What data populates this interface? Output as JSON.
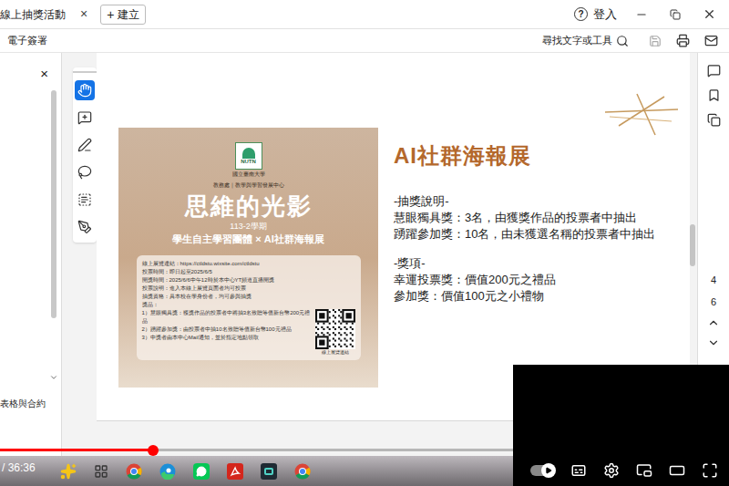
{
  "browser": {
    "tab_title": "線上抽獎活動",
    "tab_close": "×",
    "new_tab_icon": "+",
    "new_tab": "建立",
    "help": "?",
    "login": "登入"
  },
  "toolbar": {
    "left": "電子簽署",
    "search": "尋找文字或工具"
  },
  "left_panel": {
    "close": "×",
    "item": "表格與合約"
  },
  "tools": [
    {
      "kind": "hand",
      "selected": true
    },
    {
      "kind": "comment",
      "selected": false
    },
    {
      "kind": "pen",
      "selected": false
    },
    {
      "kind": "lasso",
      "selected": false
    },
    {
      "kind": "text-select",
      "selected": false
    },
    {
      "kind": "sign",
      "selected": false
    }
  ],
  "poster": {
    "logo": "NUTN",
    "school": "國立臺南大學",
    "unit": "教務處｜教學與學習發展中心",
    "title": "思維的光影",
    "term": "113-2學期",
    "subtitle": "學生自主學習團體 × AI社群海報展",
    "info": [
      "線上展覽連結：https://ctldstu.wixsite.com/ctldstu",
      "投票時間：即日起至2025/6/5",
      "開獎時間：2025/6/6中午12時於本中心YT頻道直播開獎",
      "投票說明：進入本線上展覽頁面者均可投票",
      "抽獎資格：具本校在學身份者，均可參與抽獎",
      "獎品："
    ],
    "prizes": [
      "1）慧眼獨具獎：獲獎作品的投票者中將抽3名致贈等值新台幣200元禮品",
      "2）踴躍參加獎：由投票者中抽10名致贈等值新台幣100元禮品",
      "3）中獎者由本中心Mail通知，並於指定地點領取"
    ],
    "qr_label": "線上展覽連結"
  },
  "page": {
    "title": "AI社群海報展",
    "sections": [
      {
        "heading": "-抽獎說明-",
        "lines": [
          "慧眼獨具獎：3名，由獲獎作品的投票者中抽出",
          "踴躍參加獎：10名，由未獲選名稱的投票者中抽出"
        ]
      },
      {
        "heading": "-獎項-",
        "lines": [
          "幸運投票獎：價值200元之禮品",
          "參加獎：價值100元之小禮物"
        ]
      }
    ]
  },
  "page_nav": {
    "pages": [
      "4",
      "6"
    ]
  },
  "player": {
    "time": "/ 36:36",
    "progress": 0.21,
    "autoplay": true
  },
  "taskbar": {
    "apps": [
      {
        "kind": "copilot"
      },
      {
        "kind": "taskview"
      },
      {
        "kind": "chrome"
      },
      {
        "kind": "edge"
      },
      {
        "kind": "line"
      },
      {
        "kind": "acrobat"
      },
      {
        "kind": "capture"
      },
      {
        "kind": "chrome"
      }
    ]
  }
}
